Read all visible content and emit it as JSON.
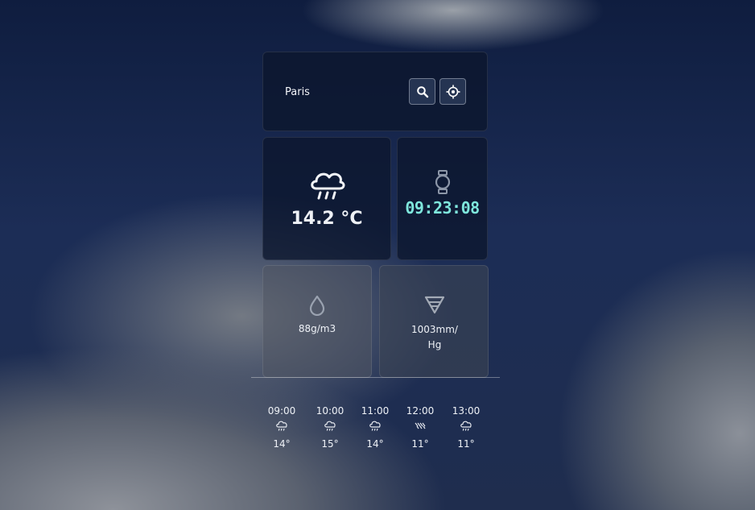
{
  "search": {
    "city": "Paris"
  },
  "icons": {
    "search": "search-icon",
    "locate": "crosshair-icon",
    "weather": "cloud-rain-icon",
    "clock": "watch-icon",
    "humidity": "droplet-icon",
    "pressure": "pressure-funnel-icon"
  },
  "current": {
    "temperature": "14.2 °C",
    "time": "09:23:08"
  },
  "humidity": "88g/m3",
  "pressure": {
    "line1": "1003mm/",
    "line2": "Hg"
  },
  "forecast": [
    {
      "time": "09:00",
      "icon": "cloud-rain-icon",
      "temp": "14°"
    },
    {
      "time": "10:00",
      "icon": "cloud-rain-icon",
      "temp": "15°"
    },
    {
      "time": "11:00",
      "icon": "cloud-rain-icon",
      "temp": "14°"
    },
    {
      "time": "12:00",
      "icon": "heavy-rain-icon",
      "temp": "11°"
    },
    {
      "time": "13:00",
      "icon": "cloud-rain-icon",
      "temp": "11°"
    }
  ],
  "colors": {
    "clock": "#7ee6dc",
    "panel": "#0c162d"
  }
}
